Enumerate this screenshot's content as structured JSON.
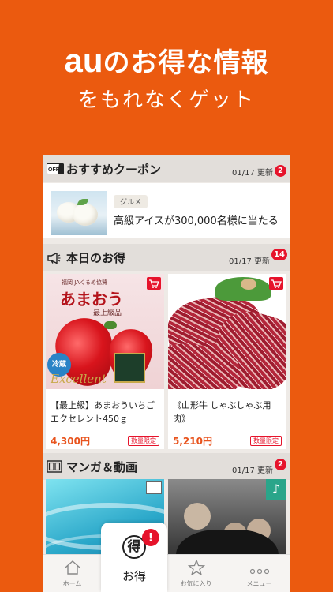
{
  "hero": {
    "title_au": "au",
    "title_rest": "のお得な情報",
    "subtitle": "をもれなくゲット"
  },
  "coupon_section": {
    "icon": "off-coupon-icon",
    "icon_text": "OFF",
    "title": "おすすめクーポン",
    "updated": "01/17 更新",
    "badge": "2",
    "item": {
      "tag": "グルメ",
      "text": "高級アイスが300,000名様に当たる"
    }
  },
  "deals_section": {
    "icon": "megaphone-icon",
    "title": "本日のお得",
    "updated": "01/17 更新",
    "badge": "14",
    "items": [
      {
        "name": "【最上級】あまおういちご エクセレント450ｇ",
        "price": "4,300円",
        "limit": "数量限定",
        "image_label_top": "福岡 JAくるめ協賛",
        "image_label_main": "あまおう",
        "image_label_grade": "最上級品",
        "image_label_cool": "冷蔵",
        "image_label_excellent": "Excellent"
      },
      {
        "name": "《山形牛 しゃぶしゃぶ用 肉》",
        "price": "5,210円",
        "limit": "数量限定"
      }
    ]
  },
  "manga_section": {
    "icon": "book-icon",
    "title": "マンガ＆動画",
    "updated": "01/17 更新",
    "badge": "2"
  },
  "tabbar": {
    "home": "ホーム",
    "deals": "お得",
    "deals_glyph": "得",
    "deals_alert": "!",
    "favorites": "お気に入り",
    "menu": "メニュー"
  },
  "colors": {
    "brand_orange": "#EB5A0F",
    "badge_red": "#E6132B",
    "price_orange": "#E8541E"
  }
}
